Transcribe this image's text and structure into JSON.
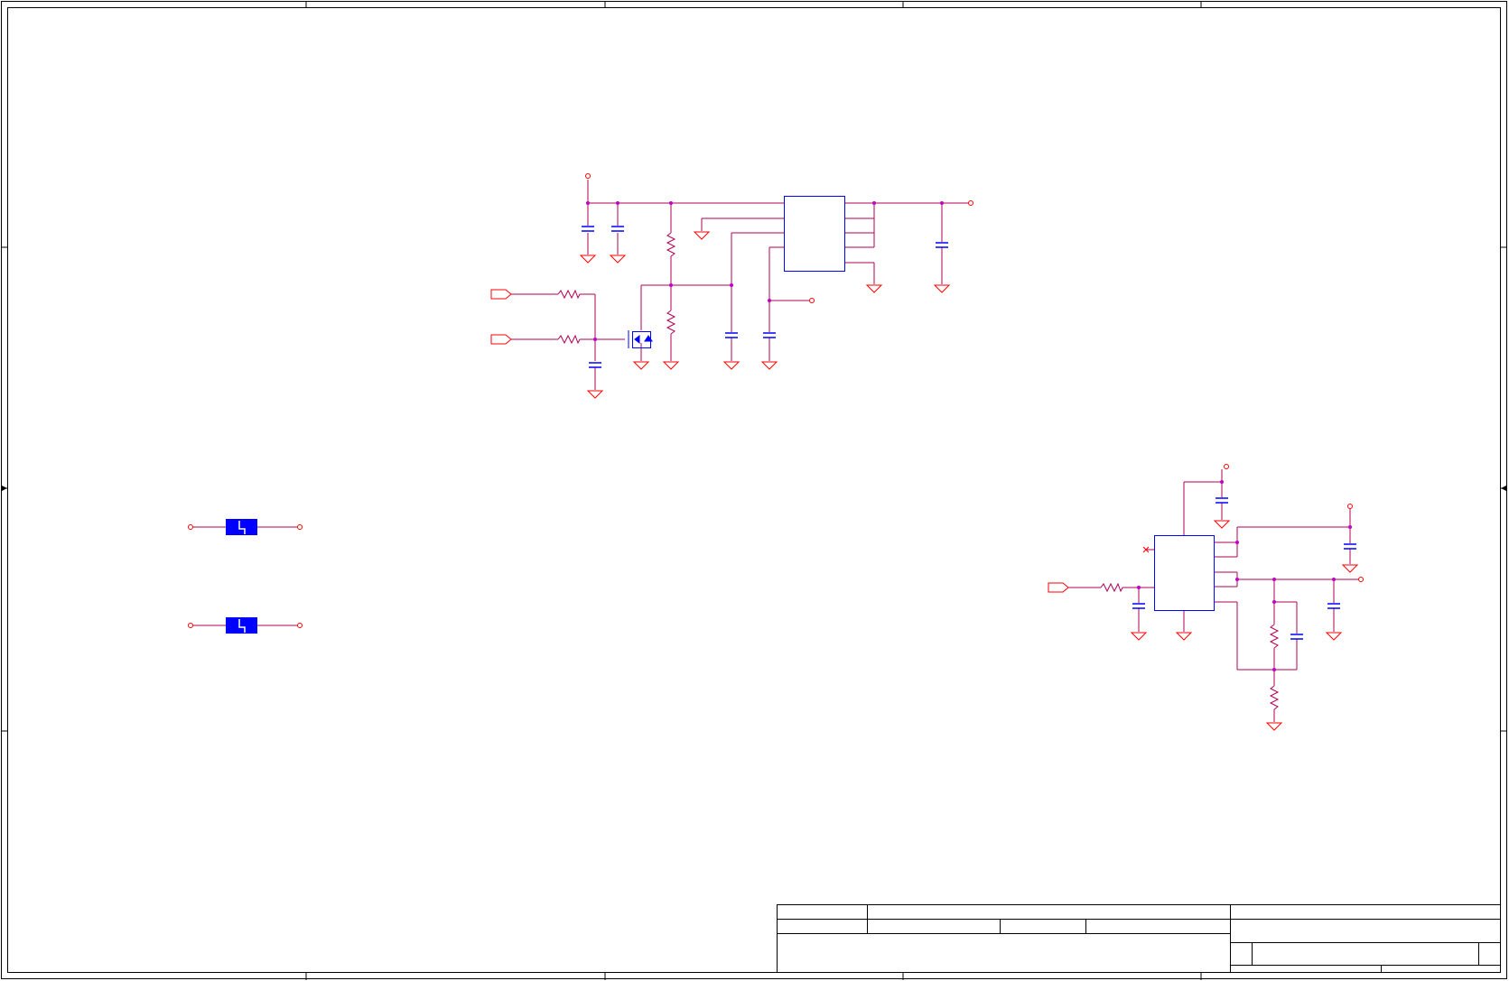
{
  "sheet": {
    "background": "#ffffff",
    "border_color": "#000000"
  },
  "colors": {
    "wire": "#b0005a",
    "component": "#0000ff",
    "net_marker": "#ff0000",
    "junction": "#c000c0",
    "block_fill": "#0000ff"
  },
  "title_block": {
    "fields": []
  }
}
